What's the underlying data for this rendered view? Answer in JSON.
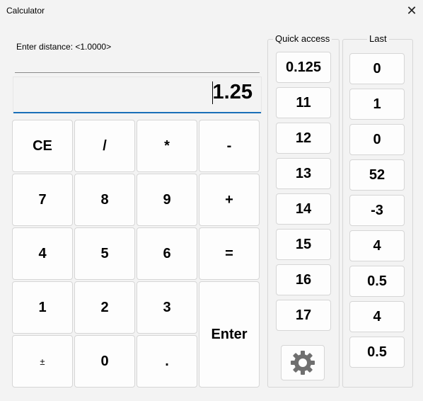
{
  "window": {
    "title": "Calculator",
    "close_glyph": "✕"
  },
  "prompt": {
    "text": "Enter distance:  <1.0000>"
  },
  "display": {
    "value": "1.25"
  },
  "keypad": {
    "ce": "CE",
    "divide": "/",
    "multiply": "*",
    "subtract": "-",
    "seven": "7",
    "eight": "8",
    "nine": "9",
    "add": "+",
    "four": "4",
    "five": "5",
    "six": "6",
    "equals": "=",
    "one": "1",
    "two": "2",
    "three": "3",
    "enter": "Enter",
    "plus_minus": "±",
    "zero": "0",
    "decimal": "."
  },
  "quick_access": {
    "title": "Quick access",
    "items": [
      "0.125",
      "11",
      "12",
      "13",
      "14",
      "15",
      "16",
      "17"
    ],
    "settings_icon": "gear-icon"
  },
  "last": {
    "title": "Last",
    "items": [
      "0",
      "1",
      "0",
      "52",
      "-3",
      "4",
      "0.5",
      "4",
      "0.5"
    ]
  }
}
